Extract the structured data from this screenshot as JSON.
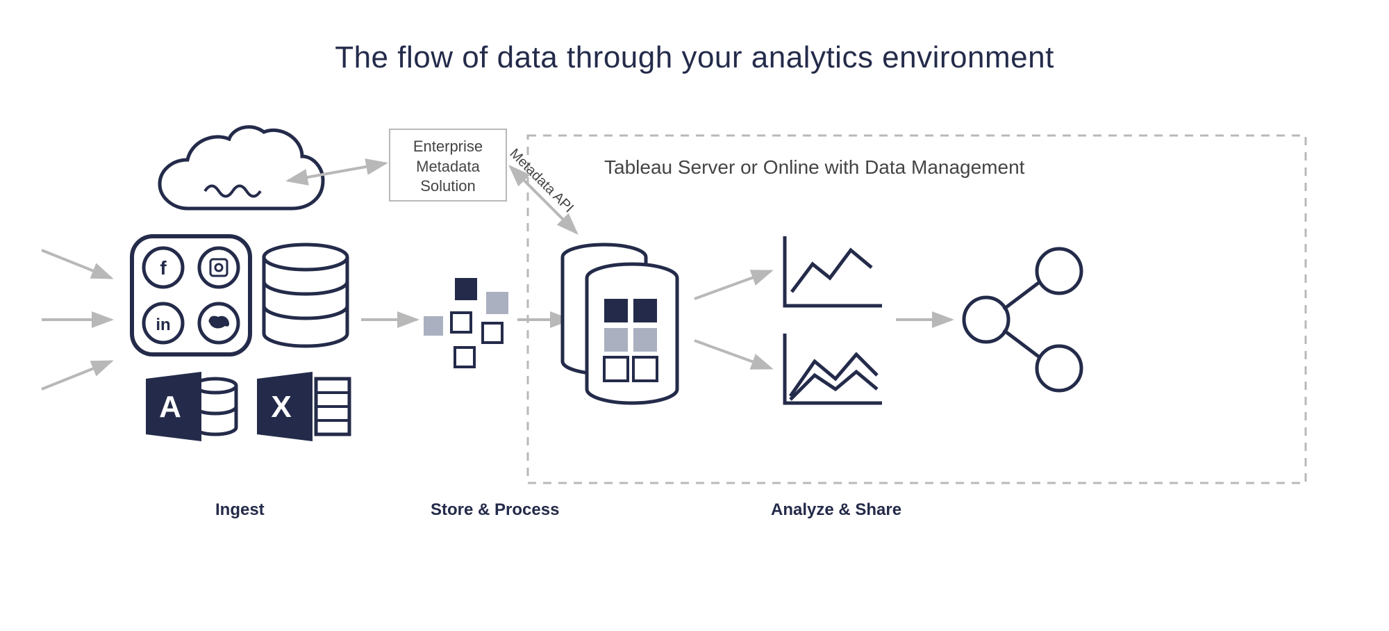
{
  "title": "The flow of data through your analytics environment",
  "stages": {
    "ingest": "Ingest",
    "store": "Store & Process",
    "analyze": "Analyze & Share"
  },
  "metadata_box": {
    "line1": "Enterprise",
    "line2": "Metadata",
    "line3": "Solution"
  },
  "server_panel_title": "Tableau Server or Online with Data Management",
  "api_label": "Metadata API",
  "colors": {
    "navy": "#242b4a",
    "grey_line": "#b8b8b8",
    "grey_fill": "#aab0c0"
  }
}
